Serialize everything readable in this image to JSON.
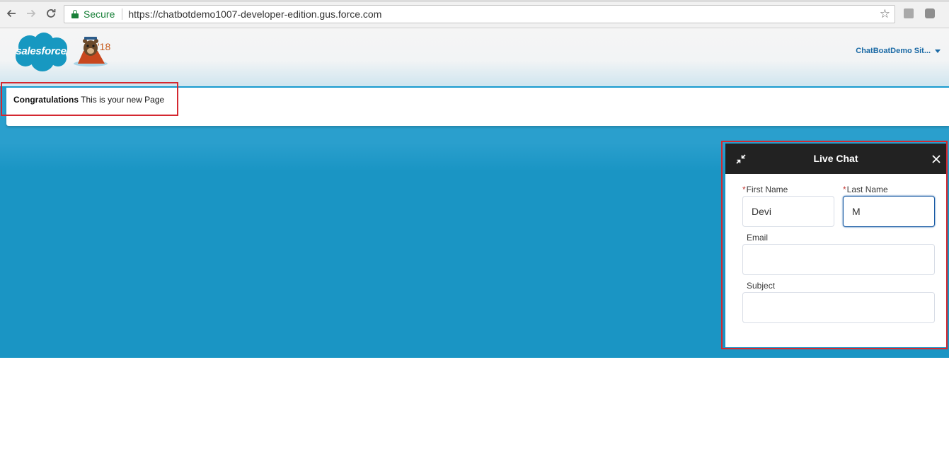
{
  "browser": {
    "secure_label": "Secure",
    "url": "https://chatbotdemo1007-developer-edition.gus.force.com"
  },
  "header": {
    "logo_text": "salesforce",
    "mascot_year": "'18",
    "site_menu_label": "ChatBoatDemo Sit..."
  },
  "page": {
    "congrats_bold": "Congratulations",
    "congrats_rest": " This is your new Page"
  },
  "chat": {
    "title": "Live Chat",
    "first_name_label": "First Name",
    "first_name_value": "Devi",
    "last_name_label": "Last Name",
    "last_name_value": "M",
    "email_label": "Email",
    "email_value": "",
    "subject_label": "Subject",
    "subject_value": "",
    "required_marker": "*"
  },
  "colors": {
    "brand_blue": "#1a95c4",
    "chat_header": "#222222",
    "annotation_red": "#d42830",
    "secure_green": "#188038"
  }
}
